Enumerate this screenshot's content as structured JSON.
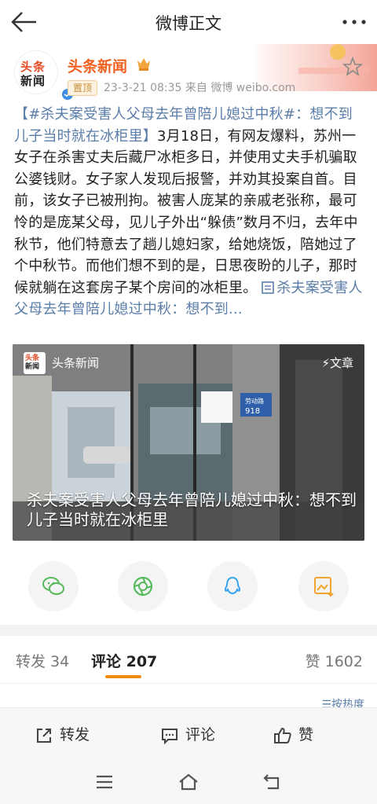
{
  "topbar": {
    "title": "微博正文",
    "back_icon": "back-arrow-icon",
    "more_icon": "more-dots-icon"
  },
  "author": {
    "avatar_line1": "头条",
    "avatar_line2": "新闻",
    "name": "头条新闻",
    "pin_label": "置顶",
    "meta": "23-3-21 08:35  来自 微博 weibo.com",
    "accent": "#f0601e"
  },
  "post": {
    "topic": "【#杀夫案受害人父母去年曾陪儿媳过中秋#：想不到儿子当时就在冰柜里】",
    "body": "3月18日，有网友爆料，苏州一女子在杀害丈夫后藏尸冰柜多日，并使用丈夫手机骗取公婆钱财。女子家人发现后报警，并劝其投案自首。目前，该女子已被刑拘。被害人庞某的亲戚老张称，最可怜的是庞某父母，见儿子外出“躲债”数月不归，去年中秋节，他们特意去了趟儿媳妇家，给她烧饭，陪她过了个中秋节。而他们想不到的是，日思夜盼的儿子，那时候就躺在这套房子某个房间的冰柜里。 ",
    "link_text": "杀夫案受害人父母去年曾陪儿媳过中秋：想不到...",
    "link_color": "#5a7da9"
  },
  "video": {
    "source_logo_line1": "头条",
    "source_logo_line2": "新闻",
    "source_name": "头条新闻",
    "tag": "⚡文章",
    "caption": "杀夫案受害人父母去年曾陪儿媳过中秋：想不到儿子当时就在冰柜里",
    "street_sign_line1": "劳动路",
    "street_sign_line2": "918"
  },
  "share": [
    {
      "icon": "wechat-icon"
    },
    {
      "icon": "moments-icon"
    },
    {
      "icon": "qq-icon"
    },
    {
      "icon": "save-image-icon"
    }
  ],
  "tabs": {
    "repost": "转发 34",
    "comment": "评论 207",
    "like": "赞 1602",
    "sort": "☰按热度"
  },
  "actions": {
    "repost": "转发",
    "comment": "评论",
    "like": "赞"
  },
  "system_nav": {
    "menu_icon": "menu-icon",
    "home_icon": "home-icon",
    "back_icon": "return-icon"
  }
}
